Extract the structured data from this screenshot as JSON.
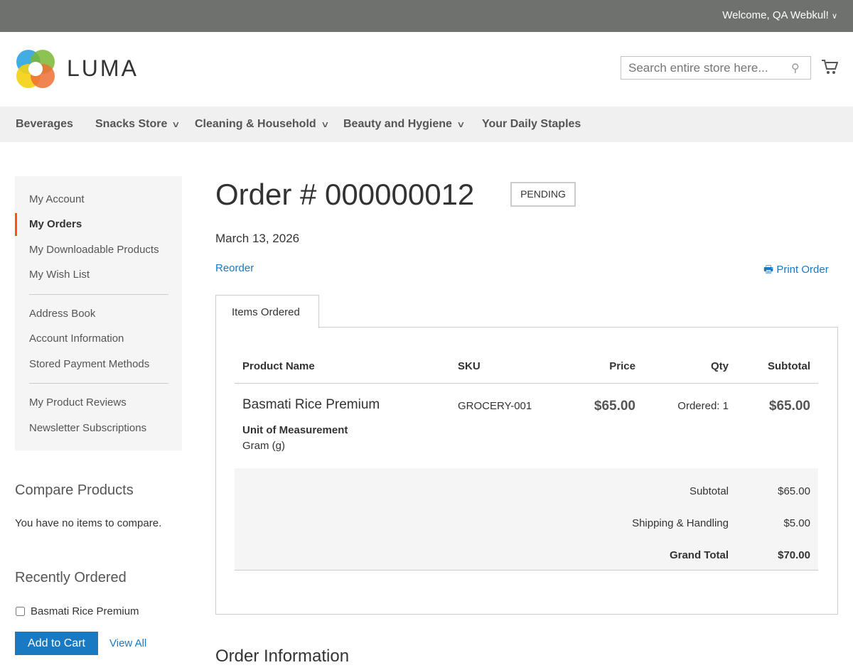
{
  "header": {
    "welcome": "Welcome, QA Webkul!",
    "logo": "LUMA",
    "search_placeholder": "Search entire store here..."
  },
  "nav": [
    "Beverages",
    "Snacks Store",
    "Cleaning & Household",
    "Beauty and Hygiene",
    "Your Daily Staples"
  ],
  "sidebar": {
    "items": [
      "My Account",
      "My Orders",
      "My Downloadable Products",
      "My Wish List",
      "Address Book",
      "Account Information",
      "Stored Payment Methods",
      "My Product Reviews",
      "Newsletter Subscriptions"
    ],
    "active": "My Orders"
  },
  "compare": {
    "title": "Compare Products",
    "empty": "You have no items to compare."
  },
  "recent": {
    "title": "Recently Ordered",
    "item": "Basmati Rice Premium",
    "add_to_cart": "Add to Cart",
    "view_all": "View All"
  },
  "order": {
    "title": "Order # 000000012",
    "status": "PENDING",
    "date": "March 13, 2026",
    "reorder": "Reorder",
    "print": "Print Order",
    "tab": "Items Ordered",
    "columns": [
      "Product Name",
      "SKU",
      "Price",
      "Qty",
      "Subtotal"
    ],
    "item": {
      "name": "Basmati Rice Premium",
      "sku": "GROCERY-001",
      "price": "$65.00",
      "qty": "Ordered: 1",
      "subtotal": "$65.00",
      "option_label": "Unit of Measurement",
      "option_value": "Gram (g)"
    },
    "totals": [
      {
        "label": "Subtotal",
        "value": "$65.00"
      },
      {
        "label": "Shipping & Handling",
        "value": "$5.00"
      },
      {
        "label": "Grand Total",
        "value": "$70.00"
      }
    ],
    "info_title": "Order Information"
  }
}
